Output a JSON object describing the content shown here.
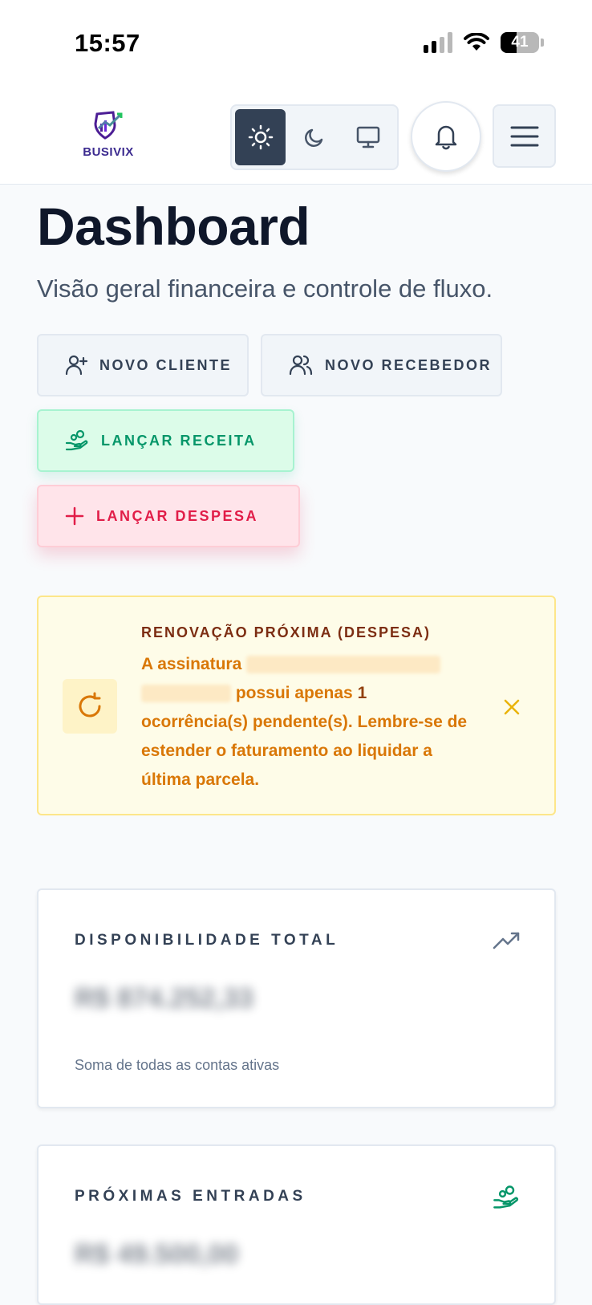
{
  "status_bar": {
    "time": "15:57",
    "battery": "41"
  },
  "header": {
    "logo_text": "BUSIVIX"
  },
  "page": {
    "title": "Dashboard",
    "subtitle": "Visão geral financeira e controle de fluxo."
  },
  "actions": {
    "new_client": "NOVO CLIENTE",
    "new_receiver": "NOVO RECEBEDOR",
    "add_revenue": "LANÇAR RECEITA",
    "add_expense": "LANÇAR DESPESA"
  },
  "alert": {
    "heading": "RENOVAÇÃO PRÓXIMA (DESPESA)",
    "text_start": "A assinatura",
    "text_mid": "possui apenas",
    "count": "1",
    "text_end": "ocorrência(s) pendente(s). Lembre-se de estender o faturamento ao liquidar a última parcela."
  },
  "cards": {
    "total": {
      "label": "DISPONIBILIDADE TOTAL",
      "value": "R$ 874.252,33",
      "note": "Soma de todas as contas ativas"
    },
    "incoming": {
      "label": "PRÓXIMAS ENTRADAS",
      "value": "R$ 49.500,00"
    }
  },
  "colors": {
    "primary_dark": "#334155",
    "success": "#059669",
    "danger": "#e11d48",
    "warning": "#d97706"
  }
}
